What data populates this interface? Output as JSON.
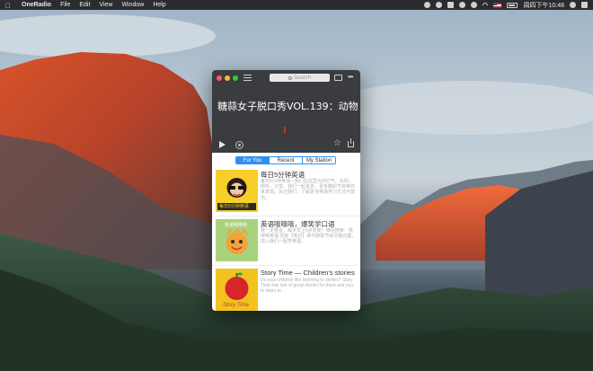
{
  "menubar": {
    "app_name": "OneRadio",
    "menus": [
      "File",
      "Edit",
      "View",
      "Window",
      "Help"
    ],
    "clock": "周四下午10:48"
  },
  "window": {
    "search_placeholder": "Search",
    "now_playing": "糖蒜女子脱口秀VOL.139：动物"
  },
  "tabs": [
    {
      "label": "For You",
      "active": true
    },
    {
      "label": "Recent",
      "active": false
    },
    {
      "label": "My Station",
      "active": false
    }
  ],
  "stations": [
    {
      "title": "每日5分钟英语",
      "description": "每日5分钟英语—我们在这里为你打气，为你，倾听，分享。我们一起进步，更多精彩节目等你来发现。关注我们，了解更多英语学习方法与技巧。",
      "thumb_text": "每日5分钟英语"
    },
    {
      "title": "英语嘻嘻嘻，爆笑学口语",
      "description": "我一定要说，每天早上6点更新！微信搜索：嘻嘻嘻英语 回复【笔记】即可获取节目文稿合集，加入我们一起学英语。",
      "thumb_text": "英语嘻嘻嘻"
    },
    {
      "title": "Story Time — Children's stories",
      "description": "Do your children like listening to stories? Story Time has lots of great stories for them and you to listen to.",
      "thumb_text": "Story Time"
    }
  ]
}
